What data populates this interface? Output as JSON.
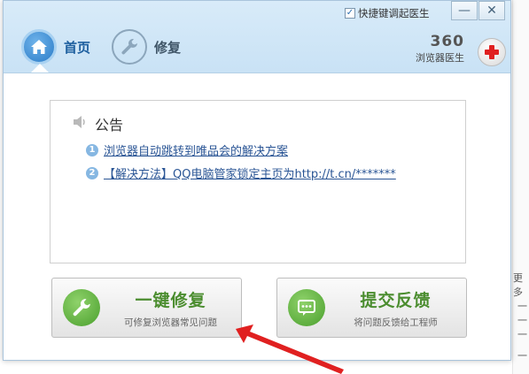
{
  "window": {
    "quick_launch_label": "快捷键调起医生",
    "quick_launch_checked": "✓",
    "minimize_glyph": "—",
    "close_glyph": "✕"
  },
  "tabs": [
    {
      "label": "首页",
      "icon": "home-icon",
      "active": true
    },
    {
      "label": "修复",
      "icon": "wrench-icon",
      "active": false
    }
  ],
  "brand": {
    "number": "360",
    "subtitle": "浏览器医生",
    "logo_icon": "medical-cross-icon"
  },
  "notice": {
    "title": "公告",
    "title_icon": "speaker-icon",
    "items": [
      {
        "index": "1",
        "text": "浏览器自动跳转到唯品会的解决方案"
      },
      {
        "index": "2",
        "text": "【解决方法】QQ电脑管家锁定主页为http://t.cn/*******"
      }
    ]
  },
  "actions": {
    "repair": {
      "title": "一键修复",
      "subtitle": "可修复浏览器常见问题",
      "icon": "wrench-icon"
    },
    "feedback": {
      "title": "提交反馈",
      "subtitle": "将问题反馈给工程师",
      "icon": "chat-icon"
    }
  },
  "background": {
    "right_col_items": [
      "更多",
      "一",
      "一",
      "一",
      "一"
    ]
  },
  "colors": {
    "accent_blue": "#2b7cc8",
    "action_green": "#4b8d2f",
    "annotation_red": "#e02020"
  }
}
